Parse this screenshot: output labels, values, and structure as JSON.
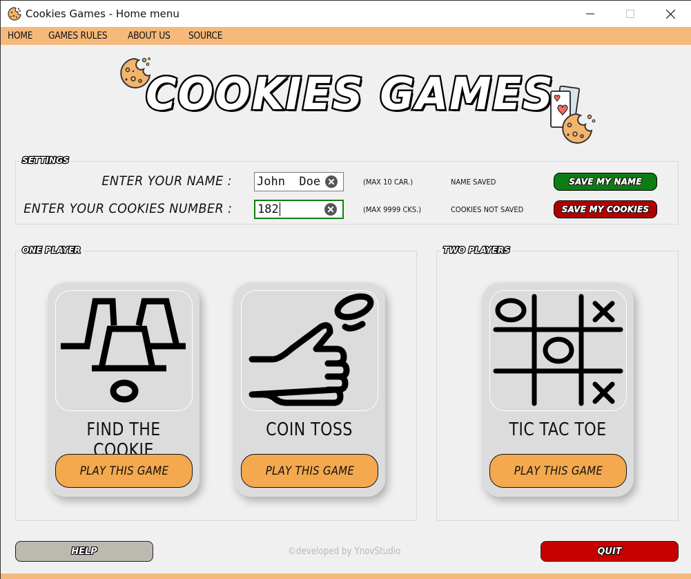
{
  "window": {
    "title": "Cookies Games - Home menu",
    "app_icon": "cookie-icon",
    "controls": {
      "minimize": "minimize-icon",
      "maximize": "maximize-icon",
      "close": "close-icon"
    }
  },
  "menu": {
    "items": [
      {
        "label": "HOME"
      },
      {
        "label": "GAMES RULES"
      },
      {
        "label": "ABOUT US"
      },
      {
        "label": "SOURCE"
      }
    ]
  },
  "logo": {
    "text": "COOKIES GAMES",
    "icons": [
      "cookie-icon",
      "playing-cards-icon",
      "cookie-icon"
    ]
  },
  "settings": {
    "label": "SETTINGS",
    "name": {
      "label": "ENTER YOUR NAME :",
      "value": "John  Doe",
      "hint": "(MAX 10 CAR.)",
      "status": "NAME SAVED",
      "button": "SAVE MY NAME"
    },
    "cookies": {
      "label": "ENTER YOUR COOKIES NUMBER :",
      "value": "182",
      "hint": "(MAX 9999 CKS.)",
      "status": "COOKIES NOT SAVED",
      "button": "SAVE MY COOKIES"
    }
  },
  "one_player": {
    "label": "ONE PLAYER",
    "games": [
      {
        "title": "FIND THE COOKIE",
        "icon": "cups-icon",
        "button": "PLAY THIS GAME"
      },
      {
        "title": "COIN TOSS",
        "icon": "coin-toss-icon",
        "button": "PLAY THIS GAME"
      }
    ]
  },
  "two_players": {
    "label": "TWO PLAYERS",
    "games": [
      {
        "title": "TIC TAC TOE",
        "icon": "tic-tac-toe-icon",
        "button": "PLAY THIS GAME"
      }
    ]
  },
  "footer": {
    "help": "HELP",
    "quit": "QUIT",
    "credit": "©developed by YnovStudio"
  },
  "colors": {
    "accent": "#f4b97b",
    "play_button": "#f4a94f",
    "save_name": "#0b7d12",
    "save_cookies": "#b00000",
    "quit": "#c80000",
    "help": "#bcb9b1",
    "focus_border": "#107c10"
  }
}
